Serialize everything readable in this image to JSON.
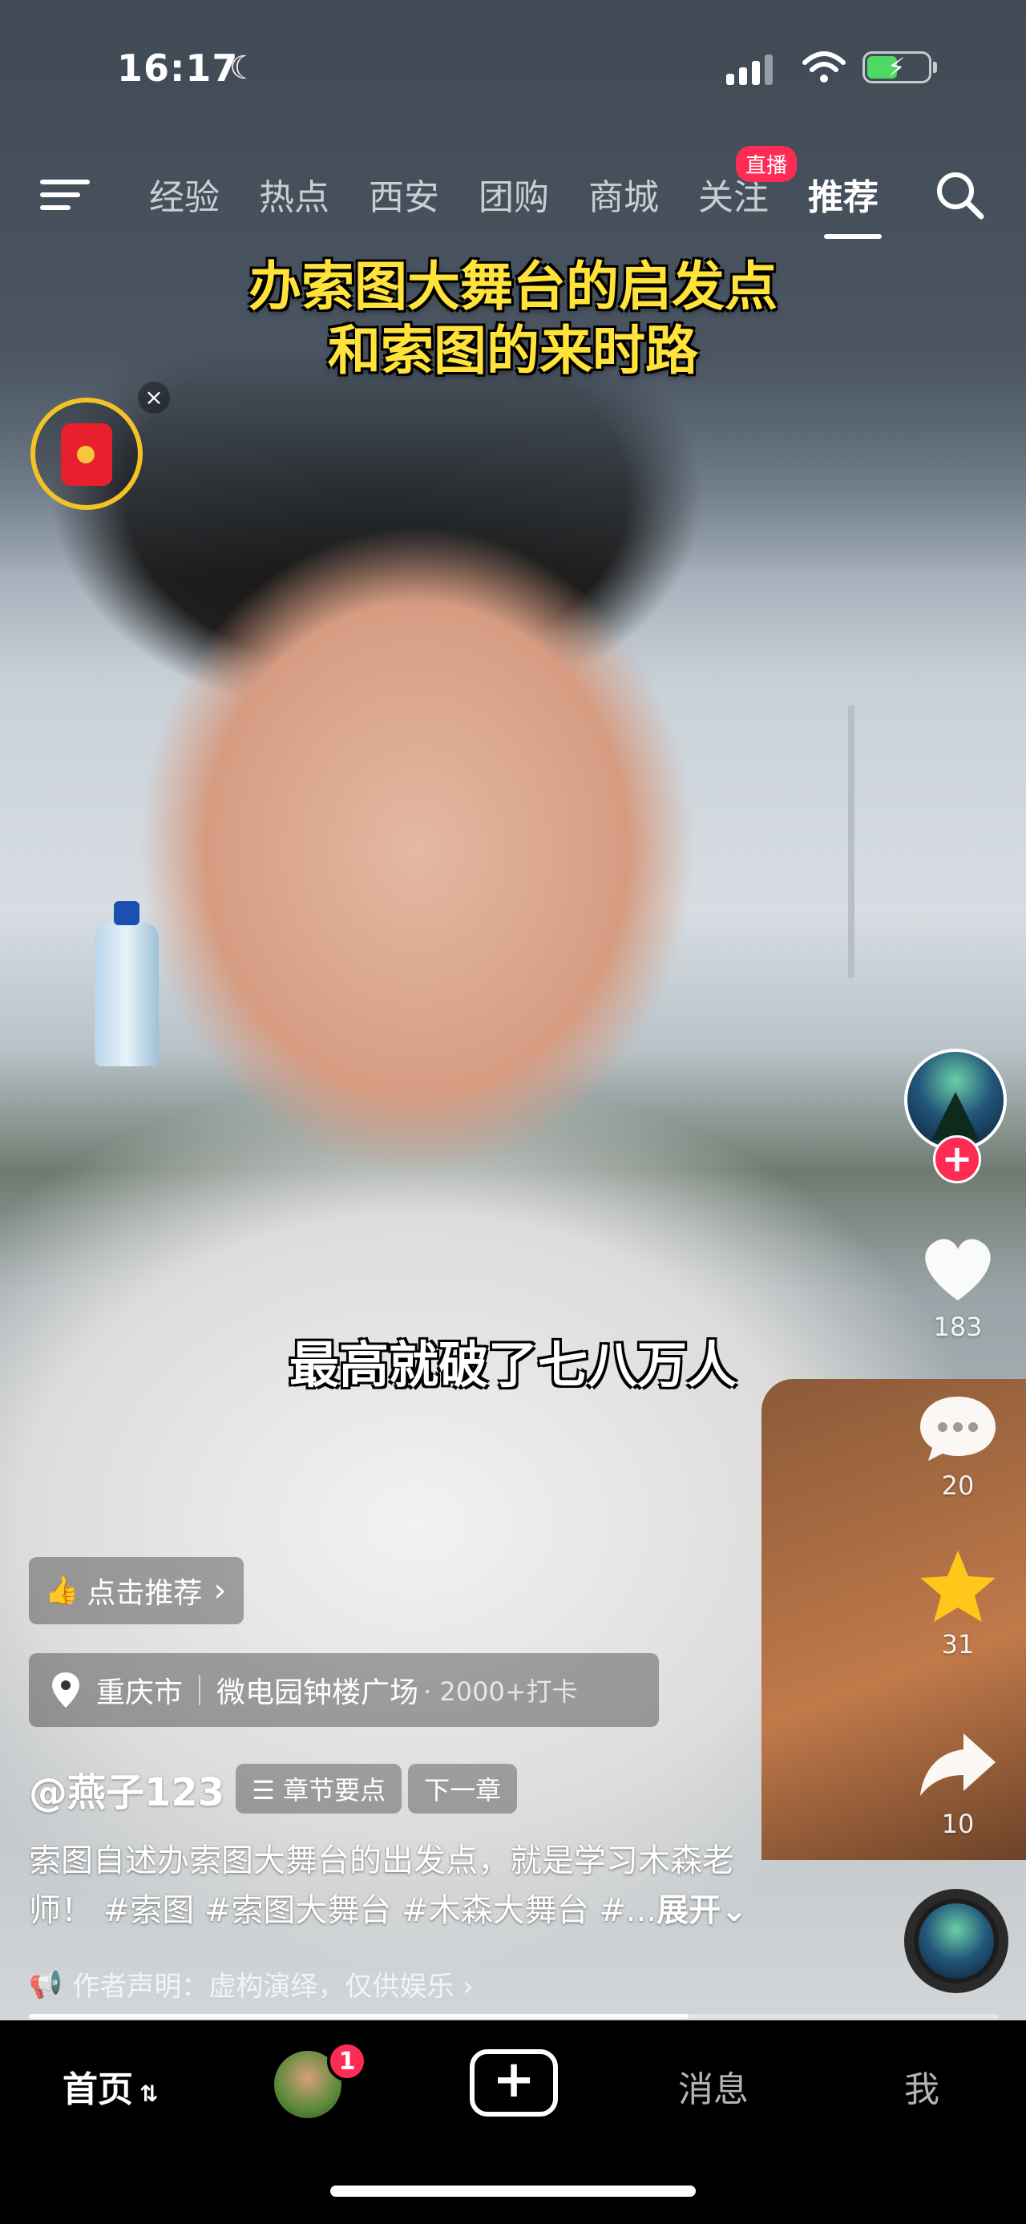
{
  "status_bar": {
    "time": "16:17"
  },
  "top_nav": {
    "tabs": [
      "经验",
      "热点",
      "西安",
      "团购",
      "商城",
      "关注",
      "推荐"
    ],
    "active_tab": "推荐",
    "live_badge": "直播"
  },
  "video": {
    "headline_line1": "办索图大舞台的启发点",
    "headline_line2": "和索图的来时路",
    "subtitle": "最高就破了七八万人"
  },
  "actions": {
    "likes": "183",
    "comments": "20",
    "favorites": "31",
    "shares": "10",
    "follow_symbol": "+"
  },
  "recommend_pill": {
    "label": "点击推荐",
    "arrow": "›"
  },
  "location": {
    "city": "重庆市",
    "place": "微电园钟楼广场",
    "meta": "· 2000+打卡"
  },
  "author": {
    "handle": "@燕子123",
    "chapter_button": "☰ 章节要点",
    "next_chapter_button": "下一章"
  },
  "description": {
    "line1": "索图自述办索图大舞台的出发点，就是学习木森老",
    "line2": "师！ #索图 #索图大舞台 #木森大舞台 #...",
    "expand": "展开⌄"
  },
  "disclaimer": {
    "text": "作者声明：虚构演绎，仅供娱乐 ›"
  },
  "playback": {
    "progress": 0.68
  },
  "bottom_tabs": {
    "home": "首页",
    "home_switch": "⇅",
    "friend_badge": "1",
    "create": "+",
    "messages": "消息",
    "me": "我"
  },
  "colors": {
    "accent": "#fe2c55",
    "headline": "#ffe23a",
    "favorite": "#ffc71a"
  }
}
